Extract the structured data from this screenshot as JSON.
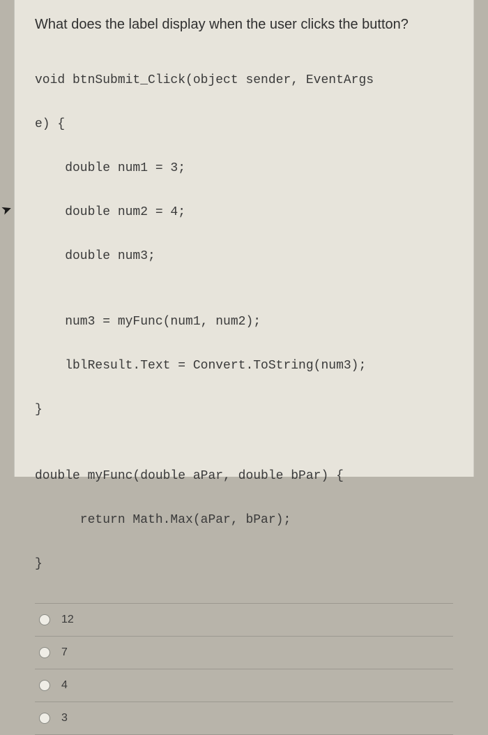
{
  "question": "What does the label display when the user clicks the button?",
  "code": {
    "l1": "void btnSubmit_Click(object sender, EventArgs",
    "l2": "e) {",
    "l3": "    double num1 = 3;",
    "l4": "    double num2 = 4;",
    "l5": "    double num3;",
    "l6": "",
    "l7": "    num3 = myFunc(num1, num2);",
    "l8": "    lblResult.Text = Convert.ToString(num3);",
    "l9": "}",
    "l10": "",
    "l11": "double myFunc(double aPar, double bPar) {",
    "l12": "      return Math.Max(aPar, bPar);",
    "l13": "}"
  },
  "options": {
    "a": "12",
    "b": "7",
    "c": "4",
    "d": "3"
  }
}
